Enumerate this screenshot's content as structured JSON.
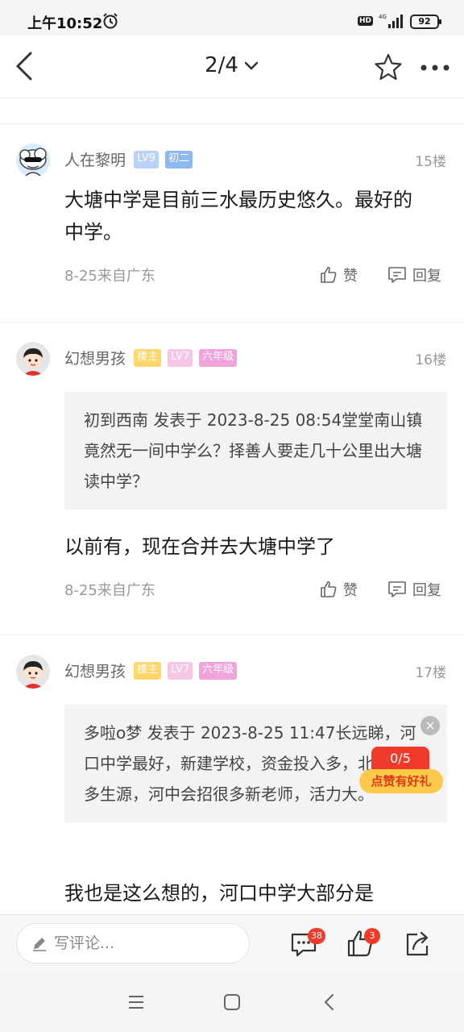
{
  "status": {
    "time": "上午10:52",
    "hd": "HD",
    "network": "4G",
    "battery": "92"
  },
  "nav": {
    "page": "2/4"
  },
  "posts": [
    {
      "username": "人在黎明",
      "badges": [
        "LV9",
        "初二"
      ],
      "floor": "15楼",
      "content": "大塘中学是目前三水最历史悠久。最好的中学。",
      "meta": "8-25来自广东",
      "like": "赞",
      "reply": "回复"
    },
    {
      "username": "幻想男孩",
      "badges": [
        "楼主",
        "LV7",
        "六年级"
      ],
      "floor": "16楼",
      "quote": "初到西南 发表于 2023-8-25 08:54堂堂南山镇竟然无一间中学么？择善人要走几十公里出大塘读中学？",
      "content": "以前有，现在合并去大塘中学了",
      "meta": "8-25来自广东",
      "like": "赞",
      "reply": "回复"
    },
    {
      "username": "幻想男孩",
      "badges": [
        "楼主",
        "LV7",
        "六年级"
      ],
      "floor": "17楼",
      "quote": "多啦o梦 发表于 2023-8-25 11:47长远睇，河口中学最好，新建学校，资金投入多，北江遍区多生源，河中会招很多新老师，活力大。",
      "content": "我也是这么想的，河口中学大部分是"
    }
  ],
  "promo": {
    "counter": "0/5",
    "label": "点赞有好礼",
    "close": "×"
  },
  "comment_bar": {
    "placeholder": "写评论...",
    "comment_count": "38",
    "like_count": "3"
  },
  "colors": {
    "accent_red": "#f03a2a",
    "badge_yellow": "#ffc94a",
    "lv9_blue": "#8fb8f0"
  },
  "icons": [
    "back-icon",
    "chevron-down-icon",
    "star-icon",
    "more-icon",
    "thumb-up-icon",
    "reply-icon",
    "comment-icon",
    "share-icon",
    "pen-icon",
    "menu-icon",
    "home-icon",
    "back-nav-icon",
    "alarm-icon",
    "signal-icon"
  ]
}
